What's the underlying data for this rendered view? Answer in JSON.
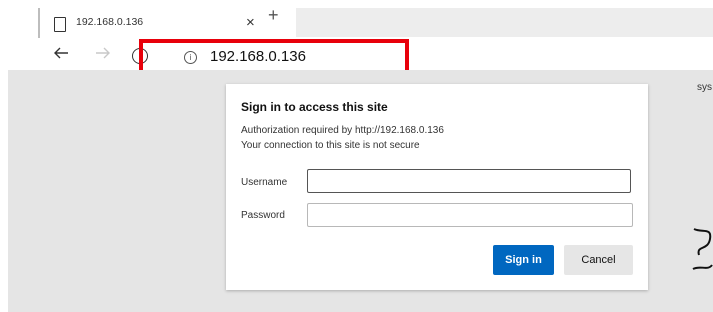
{
  "tab": {
    "title": "192.168.0.136",
    "favicon": "page-icon",
    "close_glyph": "×",
    "new_tab_glyph": "+"
  },
  "toolbar": {
    "back_icon": "back-arrow-icon",
    "forward_icon": "forward-arrow-icon",
    "refresh_icon": "refresh-icon",
    "info_icon": "info-icon",
    "url": "192.168.0.136"
  },
  "page": {
    "right_edge_text": "sys"
  },
  "dialog": {
    "title": "Sign in to access this site",
    "auth_line": "Authorization required by http://192.168.0.136",
    "security_line": "Your connection to this site is not secure",
    "username_label": "Username",
    "password_label": "Password",
    "username_value": "",
    "password_value": "",
    "sign_in_label": "Sign in",
    "cancel_label": "Cancel"
  },
  "colors": {
    "highlight": "#e8000b",
    "primary_button": "#0067c0",
    "page_background": "#e5e5e5"
  }
}
